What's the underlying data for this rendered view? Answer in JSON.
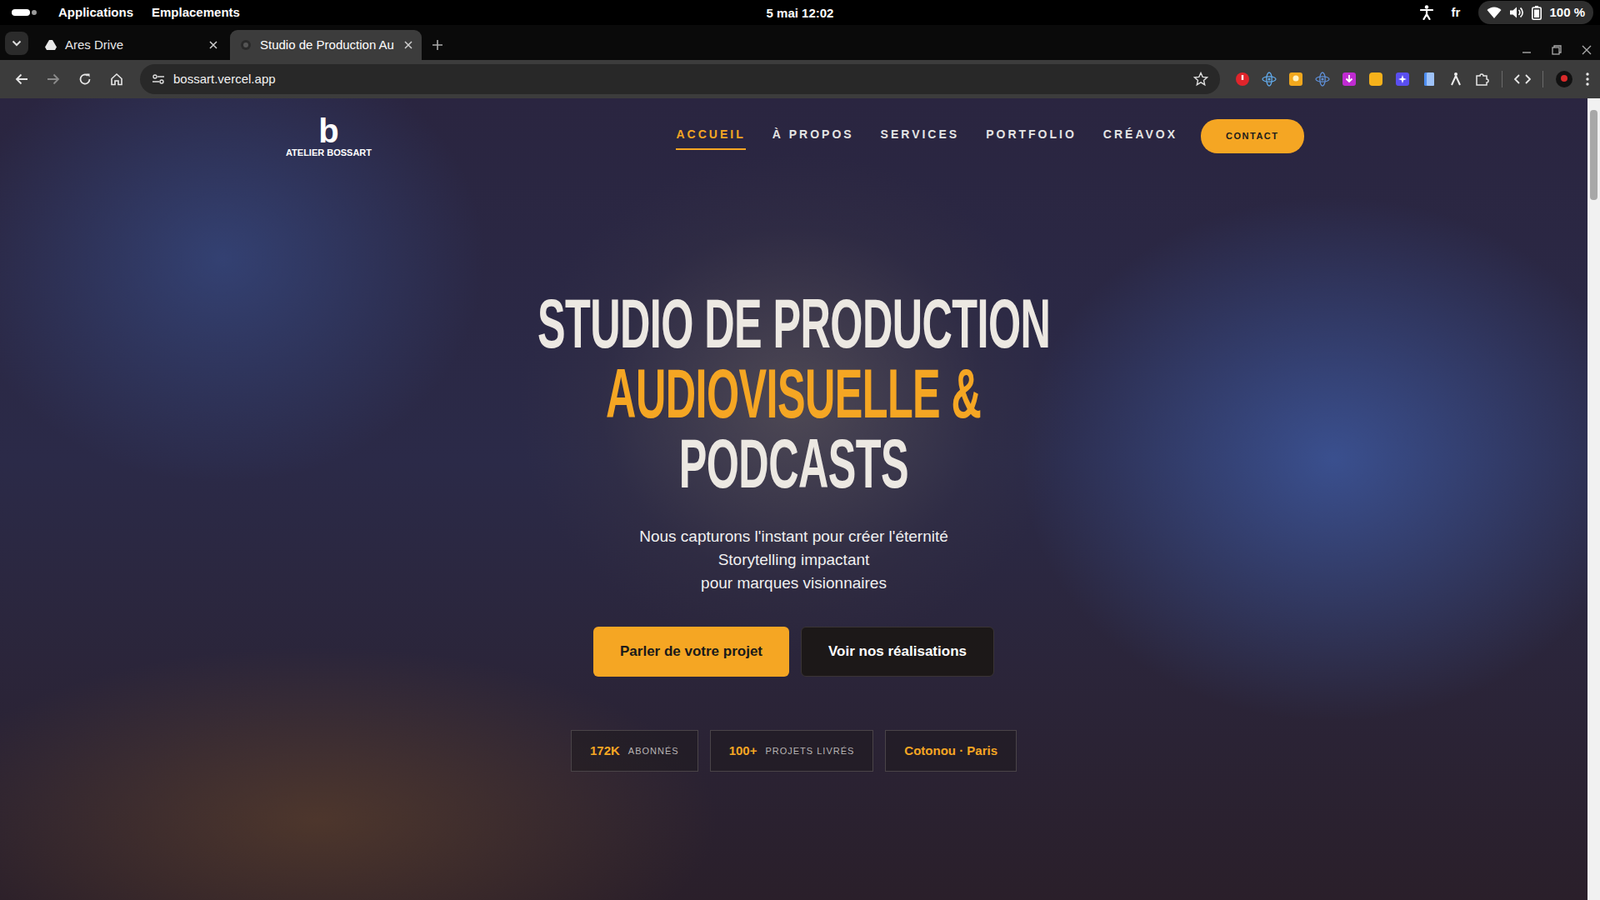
{
  "system_bar": {
    "menus": [
      "Applications",
      "Emplacements"
    ],
    "clock": "5 mai 12:02",
    "language": "fr",
    "battery": "100 %"
  },
  "tabs": [
    {
      "label": "Ares Drive",
      "selected": false
    },
    {
      "label": "Studio de Production Au",
      "selected": true
    }
  ],
  "address_bar": {
    "url": "bossart.vercel.app"
  },
  "site": {
    "logo": {
      "letter": "b",
      "name": "ATELIER BOSSART"
    },
    "nav": [
      {
        "label": "ACCUEIL",
        "selected": true
      },
      {
        "label": "À PROPOS",
        "selected": false
      },
      {
        "label": "SERVICES",
        "selected": false
      },
      {
        "label": "PORTFOLIO",
        "selected": false
      },
      {
        "label": "CRÉAVOX",
        "selected": false
      }
    ],
    "contact": "CONTACT",
    "hero": {
      "title_lines": [
        {
          "text": "STUDIO DE PRODUCTION",
          "kind": "plain"
        },
        {
          "text": "AUDIOVISUELLE &",
          "kind": "accent"
        },
        {
          "text": "PODCASTS",
          "kind": "plain"
        }
      ],
      "tagline": [
        "Nous capturons l'instant pour créer l'éternité",
        "Storytelling impactant",
        "pour marques visionnaires"
      ],
      "buttons": [
        {
          "label": "Parler de votre projet",
          "kind": "primary"
        },
        {
          "label": "Voir nos réalisations",
          "kind": "secondary"
        }
      ],
      "stats": [
        {
          "value": "172K",
          "label": "ABONNÉS"
        },
        {
          "value": "100+",
          "label": "PROJETS LIVRÉS"
        },
        {
          "value": "Cotonou · Paris"
        }
      ]
    }
  }
}
